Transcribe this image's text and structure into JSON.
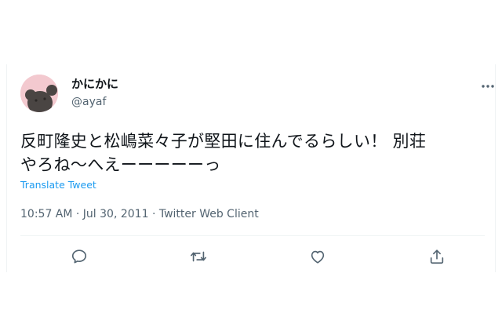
{
  "user": {
    "display_name": "かにかに",
    "handle": "@ayaf"
  },
  "tweet": {
    "text_line1": "反町隆史と松嶋菜々子が堅田に住んでるらしい！ 別荘",
    "text_line2": "やろね〜へえーーーーーっ",
    "translate_label": "Translate Tweet",
    "timestamp": "10:57 AM · Jul 30, 2011 · Twitter Web Client"
  },
  "icons": {
    "more": "more-horizontal-icon",
    "reply": "reply-icon",
    "retweet": "retweet-icon",
    "like": "heart-icon",
    "share": "share-icon"
  },
  "colors": {
    "text": "#0f1419",
    "secondary": "#536471",
    "link": "#1d9bf0",
    "divider": "#eff3f4",
    "avatar_bg": "#f3c9cf"
  }
}
